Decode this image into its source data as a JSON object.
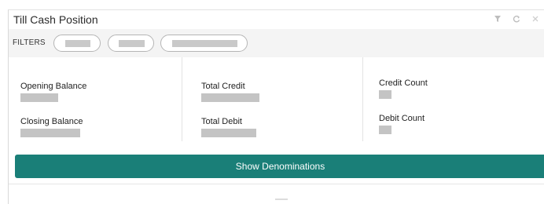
{
  "widget": {
    "title": "Till Cash Position",
    "tools": [
      "filter-icon",
      "refresh-icon",
      "close-icon"
    ]
  },
  "filters": {
    "label": "FILTERS",
    "chips": [
      "",
      "",
      ""
    ]
  },
  "summary": {
    "opening_balance_label": "Opening Balance",
    "closing_balance_label": "Closing Balance",
    "total_credit_label": "Total Credit",
    "total_debit_label": "Total Debit",
    "credit_count_label": "Credit Count",
    "debit_count_label": "Debit Count"
  },
  "actions": {
    "show_denominations": "Show Denominations"
  },
  "colors": {
    "accent": "#1a7f78",
    "filter_bar_bg": "#f4f4f4",
    "redacted": "#c4c4c4"
  }
}
